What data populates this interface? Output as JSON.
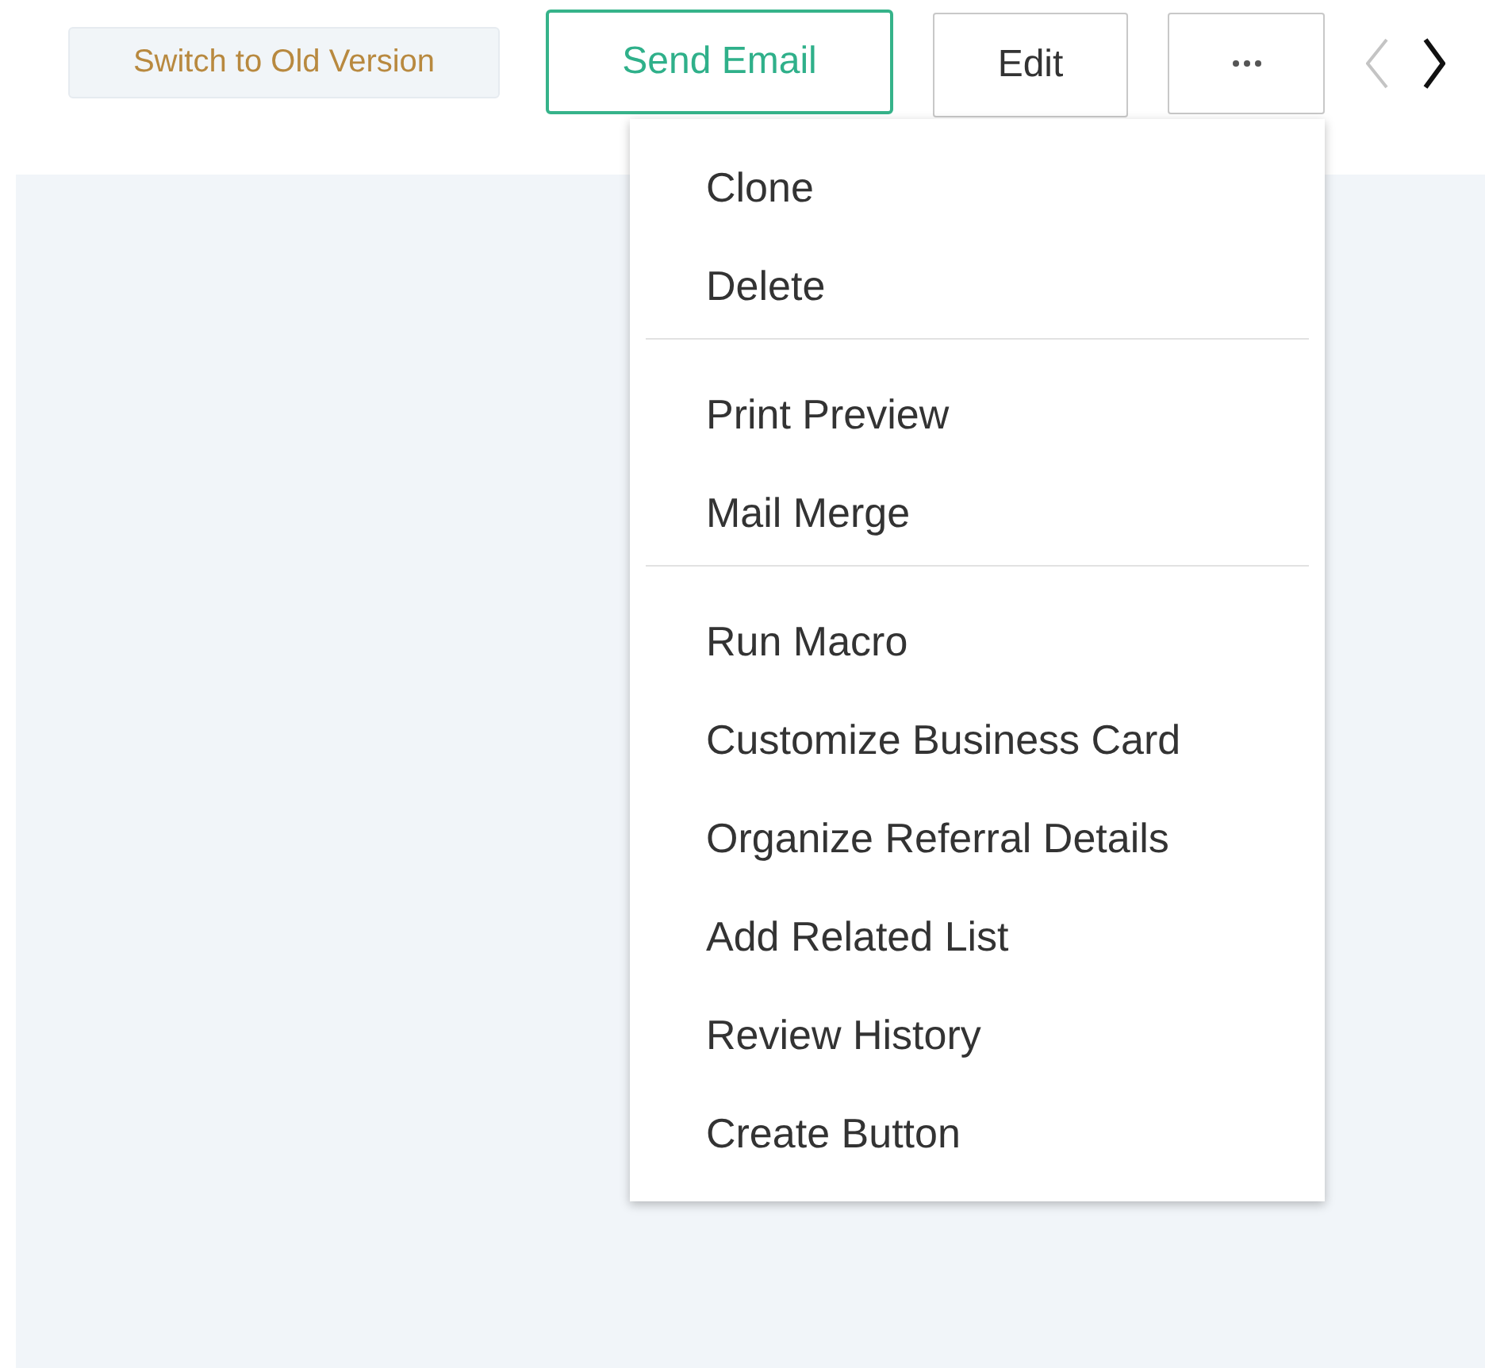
{
  "toolbar": {
    "switch_label": "Switch to Old Version",
    "send_email": "Send Email",
    "edit": "Edit",
    "prev": {
      "disabled": true
    },
    "next": {
      "disabled": false
    }
  },
  "menu": {
    "groups": [
      {
        "items": [
          "Clone",
          "Delete"
        ]
      },
      {
        "items": [
          "Print Preview",
          "Mail Merge"
        ]
      },
      {
        "items": [
          "Run Macro",
          "Customize Business Card",
          "Organize Referral Details",
          "Add Related List",
          "Review History",
          "Create Button"
        ]
      }
    ]
  }
}
